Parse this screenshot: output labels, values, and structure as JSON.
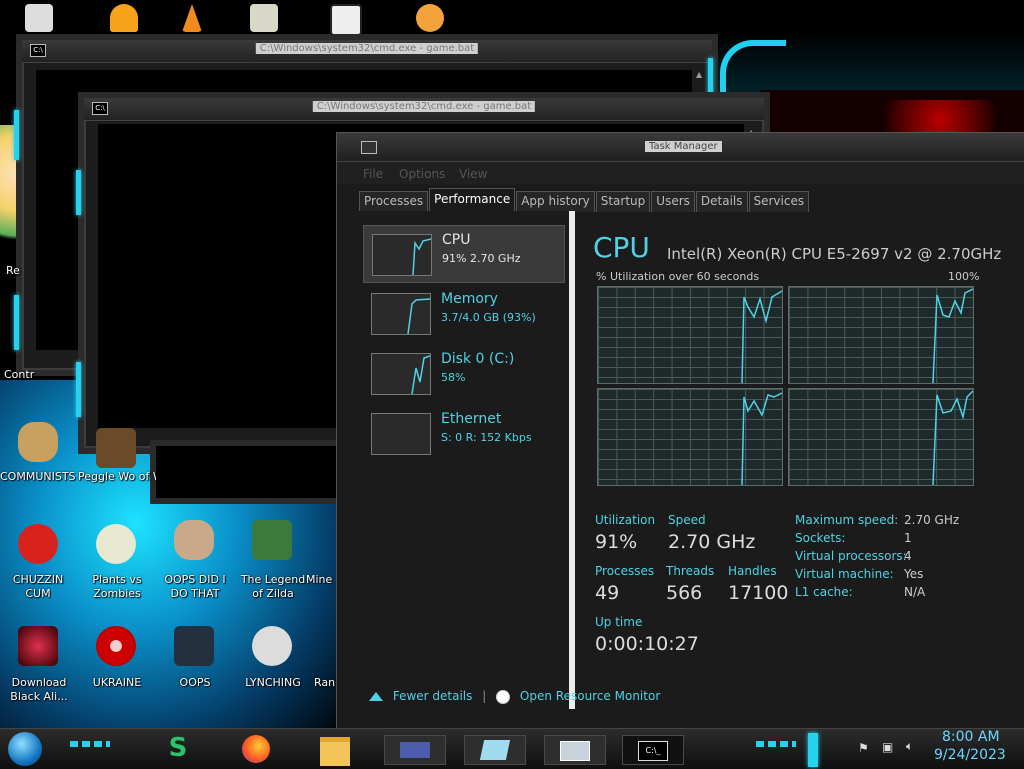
{
  "desktop": {
    "icons": [
      {
        "label": "COMMUNISTS HATE THIS G...",
        "icon": "money-bag-icon"
      },
      {
        "label": "Peggle Wo of Warcraft ...",
        "icon": "peggle-icon"
      },
      {
        "label": "CHUZZIN CUM",
        "icon": "chuzzle-icon"
      },
      {
        "label": "Plants vs Zombies",
        "icon": "flower-icon"
      },
      {
        "label": "OOPS DID I DO THAT",
        "icon": "portrait-icon"
      },
      {
        "label": "The Legend of Zilda",
        "icon": "pixel-hero-icon"
      },
      {
        "label": "Mine",
        "icon": "app-icon"
      },
      {
        "label": "Download Black Ali...",
        "icon": "black-alien-icon"
      },
      {
        "label": "UKRAINE",
        "icon": "radiation-icon"
      },
      {
        "label": "OOPS",
        "icon": "cube-icon"
      },
      {
        "label": "LYNCHING",
        "icon": "knot-icon"
      },
      {
        "label": "Ran",
        "icon": "app-icon"
      },
      {
        "label": "Re",
        "icon": "app-icon"
      },
      {
        "label": "Contr",
        "icon": "app-icon"
      }
    ]
  },
  "cmd_windows": [
    {
      "title": "C:\\Windows\\system32\\cmd.exe - game.bat"
    },
    {
      "title": "C:\\Windows\\system32\\cmd.exe - game.bat"
    }
  ],
  "task_manager": {
    "title": "Task Manager",
    "menu": [
      "File",
      "Options",
      "View"
    ],
    "tabs": [
      "Processes",
      "Performance",
      "App history",
      "Startup",
      "Users",
      "Details",
      "Services"
    ],
    "active_tab": "Performance",
    "resources": [
      {
        "name": "CPU",
        "sub": "91%  2.70 GHz"
      },
      {
        "name": "Memory",
        "sub": "3.7/4.0 GB (93%)"
      },
      {
        "name": "Disk 0 (C:)",
        "sub": "58%"
      },
      {
        "name": "Ethernet",
        "sub": "S: 0  R: 152 Kbps"
      }
    ],
    "cpu": {
      "heading": "CPU",
      "model": "Intel(R) Xeon(R) CPU E5-2697 v2 @ 2.70GHz",
      "graph_label": "% Utilization over 60 seconds",
      "graph_max": "100%",
      "stats": {
        "utilization_label": "Utilization",
        "utilization": "91%",
        "speed_label": "Speed",
        "speed": "2.70 GHz",
        "processes_label": "Processes",
        "processes": "49",
        "threads_label": "Threads",
        "threads": "566",
        "handles_label": "Handles",
        "handles": "17100",
        "uptime_label": "Up time",
        "uptime": "0:00:10:27"
      },
      "details": [
        {
          "k": "Maximum speed:",
          "v": "2.70 GHz"
        },
        {
          "k": "Sockets:",
          "v": "1"
        },
        {
          "k": "Virtual processors:",
          "v": "4"
        },
        {
          "k": "Virtual machine:",
          "v": "Yes"
        },
        {
          "k": "L1 cache:",
          "v": "N/A"
        }
      ]
    },
    "footer": {
      "fewer": "Fewer details",
      "monitor": "Open Resource Monitor"
    }
  },
  "taskbar": {
    "time": "8:00 AM",
    "date": "9/24/2023"
  },
  "colors": {
    "accent": "#4fd2e5",
    "neon": "#26d3ef"
  }
}
